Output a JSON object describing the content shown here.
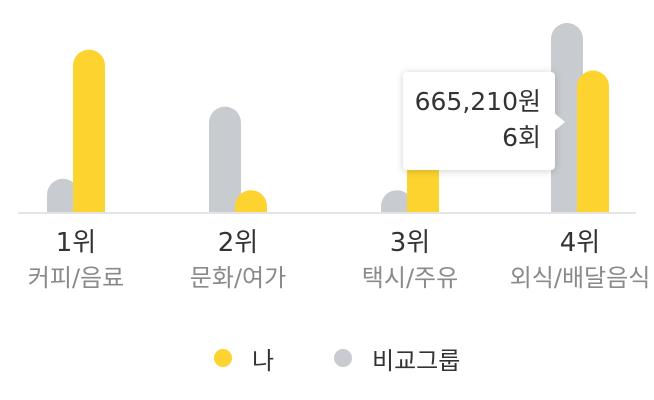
{
  "chart_data": {
    "type": "bar",
    "categories": [
      {
        "rank": "1위",
        "name": "커피/음료"
      },
      {
        "rank": "2위",
        "name": "문화/여가"
      },
      {
        "rank": "3위",
        "name": "택시/주유"
      },
      {
        "rank": "4위",
        "name": "외식/배달음식"
      }
    ],
    "series": [
      {
        "name": "비교그룹",
        "color": "#c8cbcf",
        "values": [
          0.18,
          0.56,
          0.12,
          1.0
        ]
      },
      {
        "name": "나",
        "color": "#fdd32f",
        "values": [
          0.86,
          0.12,
          0.38,
          0.75
        ]
      }
    ],
    "tooltip": {
      "amount": "665,210원",
      "count": "6회",
      "category_index": 3
    },
    "legend_position": "bottom",
    "grid": false
  }
}
